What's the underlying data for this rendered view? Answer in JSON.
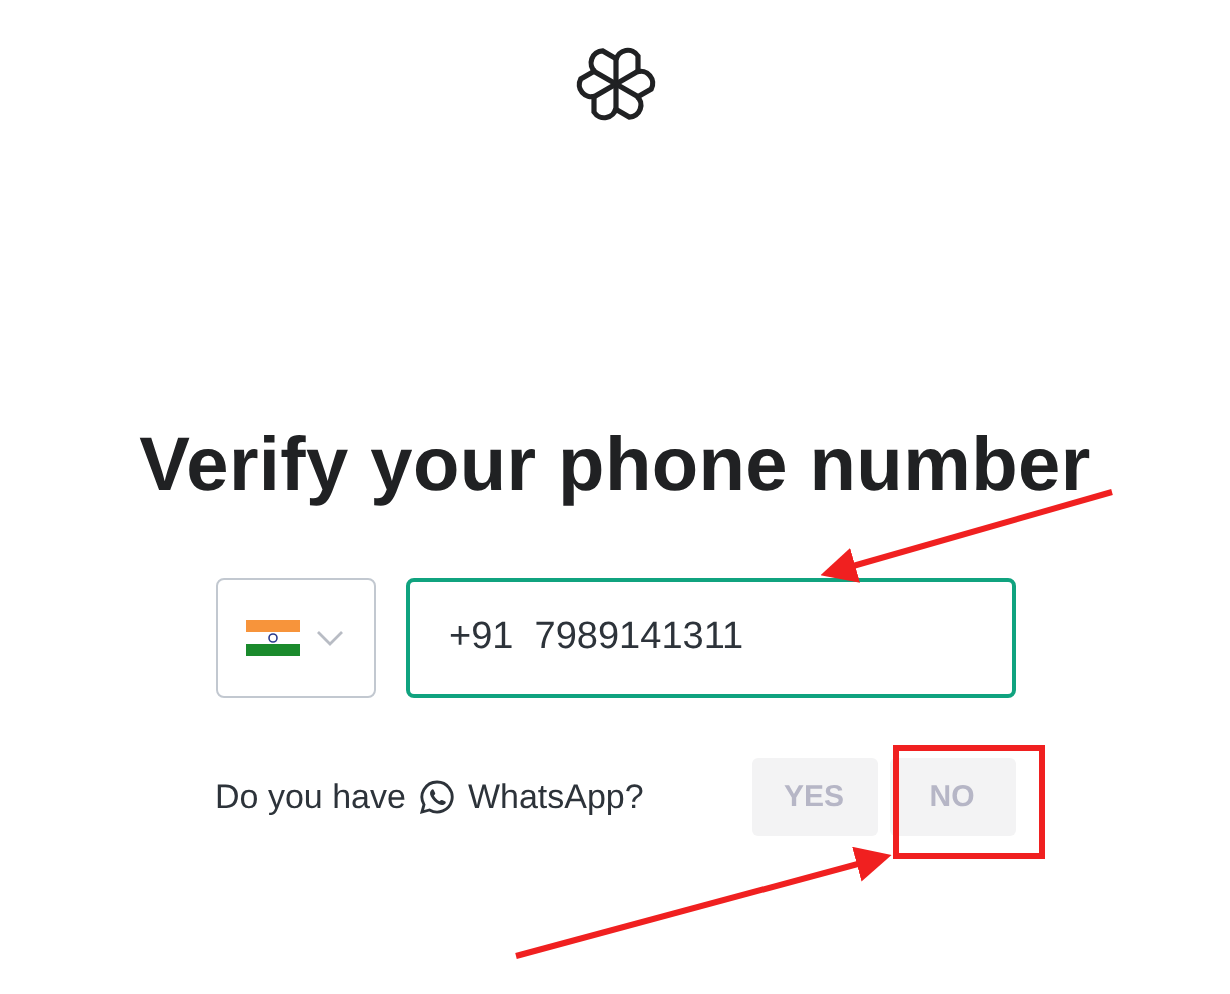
{
  "heading": "Verify your phone number",
  "phone": {
    "value": "+91  7989141311"
  },
  "whatsapp": {
    "question_start": "Do you have",
    "question_end": "WhatsApp?",
    "buttons": [
      "YES",
      "NO"
    ]
  }
}
